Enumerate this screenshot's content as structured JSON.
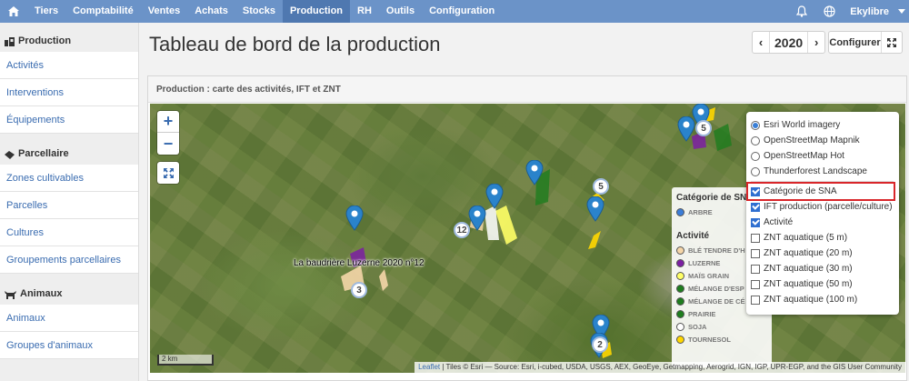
{
  "nav": {
    "items": [
      "Tiers",
      "Comptabilité",
      "Ventes",
      "Achats",
      "Stocks",
      "Production",
      "RH",
      "Outils",
      "Configuration"
    ],
    "active": "Production",
    "user": "Ekylibre"
  },
  "sidebar": {
    "sections": [
      {
        "title": "Production",
        "links": [
          "Activités",
          "Interventions",
          "Équipements"
        ]
      },
      {
        "title": "Parcellaire",
        "links": [
          "Zones cultivables",
          "Parcelles",
          "Cultures",
          "Groupements parcellaires"
        ]
      },
      {
        "title": "Animaux",
        "links": [
          "Animaux",
          "Groupes d'animaux"
        ]
      }
    ]
  },
  "page": {
    "title": "Tableau de bord de la production",
    "year": "2020",
    "configure": "Configurer"
  },
  "panel": {
    "title": "Production : carte des activités, IFT et ZNT"
  },
  "map": {
    "label": "La baudrière Luzerne 2020 n°12",
    "clusters": [
      "12",
      "5",
      "5",
      "3",
      "2"
    ],
    "scale": "2 km",
    "attribution_link": "Leaflet",
    "attribution": " | Tiles © Esri — Source: Esri, i-cubed, USDA, USGS, AEX, GeoEye, Getmapping, Aerogrid, IGN, IGP, UPR-EGP, and the GIS User Community"
  },
  "legend": {
    "sna_title": "Catégorie de SNA",
    "sna_items": [
      {
        "label": "ARBRE",
        "color": "#3b7dd8"
      }
    ],
    "activity_title": "Activité",
    "activity_items": [
      {
        "label": "BLÉ TENDRE D'H",
        "color": "#f5d6a8"
      },
      {
        "label": "LUZERNE",
        "color": "#7b1fa2"
      },
      {
        "label": "MAÏS GRAIN",
        "color": "#ffff66"
      },
      {
        "label": "MÉLANGE D'ESP",
        "color": "#1e7d1e"
      },
      {
        "label": "MÉLANGE DE CÉ",
        "color": "#1e7d1e"
      },
      {
        "label": "PRAIRIE",
        "color": "#1e7d1e"
      },
      {
        "label": "SOJA",
        "color": "#ffffff"
      },
      {
        "label": "TOURNESOL",
        "color": "#ffd700"
      }
    ]
  },
  "layers": {
    "base": [
      {
        "label": "Esri World imagery",
        "checked": true
      },
      {
        "label": "OpenStreetMap Mapnik",
        "checked": false
      },
      {
        "label": "OpenStreetMap Hot",
        "checked": false
      },
      {
        "label": "Thunderforest Landscape",
        "checked": false
      }
    ],
    "overlays": [
      {
        "label": "Catégorie de SNA",
        "checked": true
      },
      {
        "label": "IFT production (parcelle/culture)",
        "checked": true
      },
      {
        "label": "Activité",
        "checked": true
      },
      {
        "label": "ZNT aquatique (5 m)",
        "checked": false
      },
      {
        "label": "ZNT aquatique (20 m)",
        "checked": false
      },
      {
        "label": "ZNT aquatique (30 m)",
        "checked": false
      },
      {
        "label": "ZNT aquatique (50 m)",
        "checked": false
      },
      {
        "label": "ZNT aquatique (100 m)",
        "checked": false
      }
    ]
  }
}
